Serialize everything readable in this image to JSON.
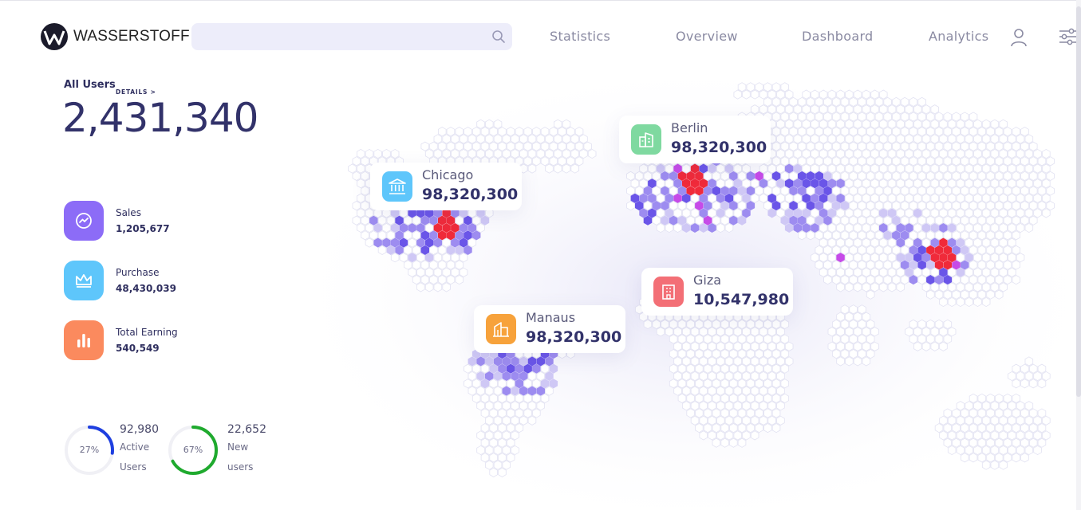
{
  "header": {
    "brand": "WASSERSTOFF",
    "search": {
      "value": "",
      "placeholder": ""
    },
    "nav": [
      "Statistics",
      "Overview",
      "Dashboard",
      "Analytics"
    ],
    "icons": {
      "search": "search-icon",
      "user": "user-icon",
      "filter": "sliders-icon"
    }
  },
  "summary": {
    "title": "All Users",
    "details_link": "DETAILS >",
    "total": "2,431,340"
  },
  "stats": [
    {
      "label": "Sales",
      "value": "1,205,677",
      "icon": "trend-icon",
      "color": "#8c6cf7"
    },
    {
      "label": "Purchase",
      "value": "48,430,039",
      "icon": "crown-icon",
      "color": "#5ec6fb"
    },
    {
      "label": "Total Earning",
      "value": "540,549",
      "icon": "bar-chart-icon",
      "color": "#fb8a5e"
    }
  ],
  "rings": [
    {
      "percent": "27%",
      "fraction": 0.27,
      "count": "92,980",
      "label_line1": "Active",
      "label_line2": "Users",
      "color": "#1e3fe0"
    },
    {
      "percent": "67%",
      "fraction": 0.67,
      "count": "22,652",
      "label_line1": "New",
      "label_line2": "users",
      "color": "#1faa2e"
    }
  ],
  "map": {
    "cities": [
      {
        "name": "Chicago",
        "value": "98,320,300",
        "color": "#5ec6fb",
        "icon": "bank-icon"
      },
      {
        "name": "Berlin",
        "value": "98,320,300",
        "color": "#7fd9a0",
        "icon": "building-icon"
      },
      {
        "name": "Manaus",
        "value": "98,320,300",
        "color": "#f7a23b",
        "icon": "house-icon"
      },
      {
        "name": "Giza",
        "value": "10,547,980",
        "color": "#f36f76",
        "icon": "office-icon"
      }
    ],
    "colors": {
      "hex": "#ffffff",
      "hex_border": "#e2e2f2",
      "light": "#cfc8f5",
      "medium": "#9d8cf0",
      "dark": "#6a55e8",
      "magenta": "#c64be8",
      "hot": "#f02a3a"
    }
  }
}
